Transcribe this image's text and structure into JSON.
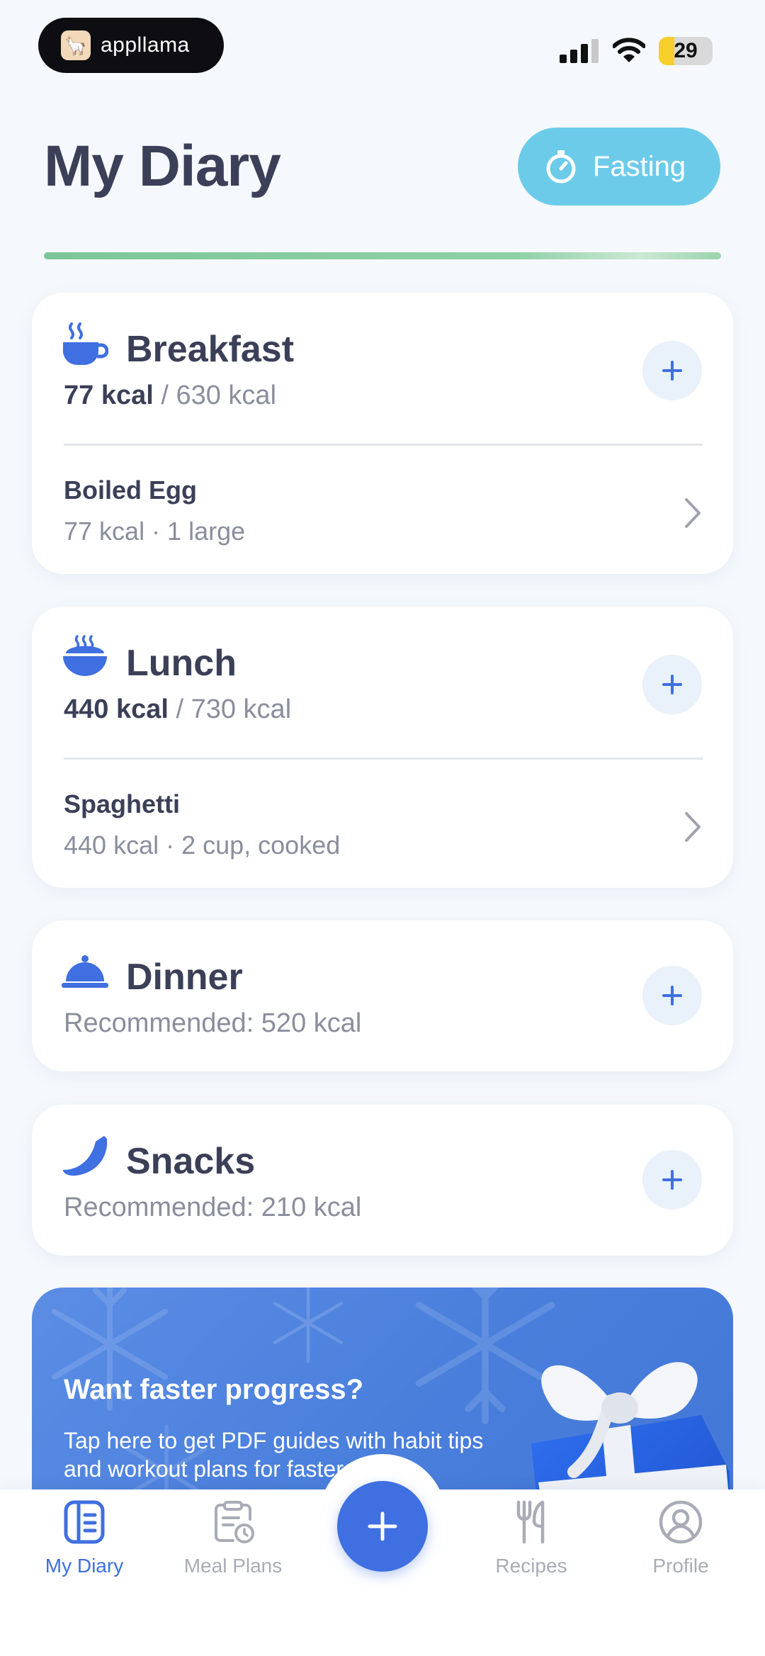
{
  "status_bar": {
    "app_pill_label": "appllama",
    "battery_level": "29",
    "battery_fraction": 0.29
  },
  "header": {
    "title": "My Diary",
    "fasting_label": "Fasting"
  },
  "meals": [
    {
      "name": "Breakfast",
      "icon": "coffee-cup-icon",
      "consumed": "77 kcal",
      "target": " / 630 kcal",
      "items": [
        {
          "name": "Boiled Egg",
          "detail": "77 kcal · 1 large"
        }
      ]
    },
    {
      "name": "Lunch",
      "icon": "soup-bowl-icon",
      "consumed": "440 kcal",
      "target": " / 730 kcal",
      "items": [
        {
          "name": "Spaghetti",
          "detail": "440 kcal · 2 cup, cooked"
        }
      ]
    },
    {
      "name": "Dinner",
      "icon": "cloche-icon",
      "recommended": "Recommended: 520 kcal"
    },
    {
      "name": "Snacks",
      "icon": "banana-icon",
      "recommended": "Recommended: 210 kcal"
    }
  ],
  "promo": {
    "title": "Want faster progress?",
    "description": "Tap here to get PDF guides with habit tips and workout plans for faster results."
  },
  "bottom_nav": {
    "items": [
      {
        "label": "My Diary",
        "icon": "diary-icon",
        "active": true
      },
      {
        "label": "Meal Plans",
        "icon": "meal-plans-icon",
        "active": false
      },
      {
        "label": "Recipes",
        "icon": "fork-knife-icon",
        "active": false
      },
      {
        "label": "Profile",
        "icon": "profile-icon",
        "active": false
      }
    ]
  },
  "colors": {
    "accent": "#3f6fe0",
    "fasting": "#6ccbe9",
    "progress": "#7cc699",
    "text_primary": "#3b3f57",
    "text_secondary": "#8a8d9c"
  }
}
